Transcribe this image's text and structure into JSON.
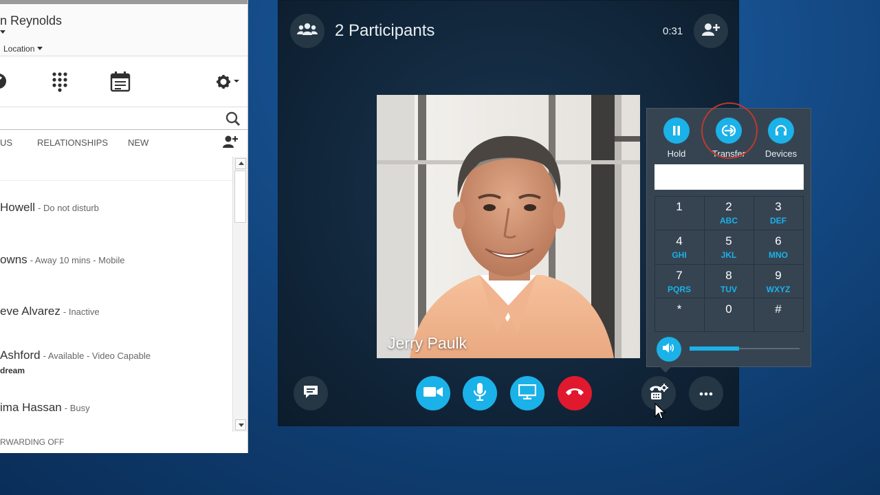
{
  "contacts_window": {
    "user_name": "n Reynolds",
    "location_label": "Location",
    "tabs": [
      "US",
      "RELATIONSHIPS",
      "NEW"
    ],
    "contacts": [
      {
        "name": "Howell",
        "status": "- Do not disturb",
        "note": ""
      },
      {
        "name": "owns",
        "status": "- Away 10 mins - Mobile",
        "note": ""
      },
      {
        "name": "eve Alvarez",
        "status": "- Inactive",
        "note": ""
      },
      {
        "name": "Ashford",
        "status": "- Available - Video Capable",
        "note": "dream"
      },
      {
        "name": "ima Hassan",
        "status": "- Busy",
        "note": ""
      }
    ],
    "forwarding": "RWARDING OFF"
  },
  "call_window": {
    "title": "2 Participants",
    "timer": "0:31",
    "caller_name": "Jerry Paulk",
    "controls": [
      "chat-icon",
      "video-icon",
      "microphone-icon",
      "present-screen-icon",
      "hang-up-icon",
      "call-controls-icon",
      "more-options-icon"
    ]
  },
  "dialpad": {
    "actions": [
      {
        "label": "Hold",
        "icon": "pause-icon"
      },
      {
        "label": "Transfer",
        "icon": "transfer-icon"
      },
      {
        "label": "Devices",
        "icon": "headset-icon"
      }
    ],
    "input_value": "",
    "keys": [
      {
        "digit": "1",
        "letters": ""
      },
      {
        "digit": "2",
        "letters": "ABC"
      },
      {
        "digit": "3",
        "letters": "DEF"
      },
      {
        "digit": "4",
        "letters": "GHI"
      },
      {
        "digit": "5",
        "letters": "JKL"
      },
      {
        "digit": "6",
        "letters": "MNO"
      },
      {
        "digit": "7",
        "letters": "PQRS"
      },
      {
        "digit": "8",
        "letters": "TUV"
      },
      {
        "digit": "9",
        "letters": "WXYZ"
      },
      {
        "digit": "*",
        "letters": ""
      },
      {
        "digit": "0",
        "letters": ""
      },
      {
        "digit": "#",
        "letters": ""
      }
    ],
    "volume_level": 0.45
  },
  "colors": {
    "accent_blue": "#1ab2e8",
    "hang_up_red": "#e0192e",
    "call_bg": "#132a40",
    "highlight_ring": "#c0392b"
  }
}
